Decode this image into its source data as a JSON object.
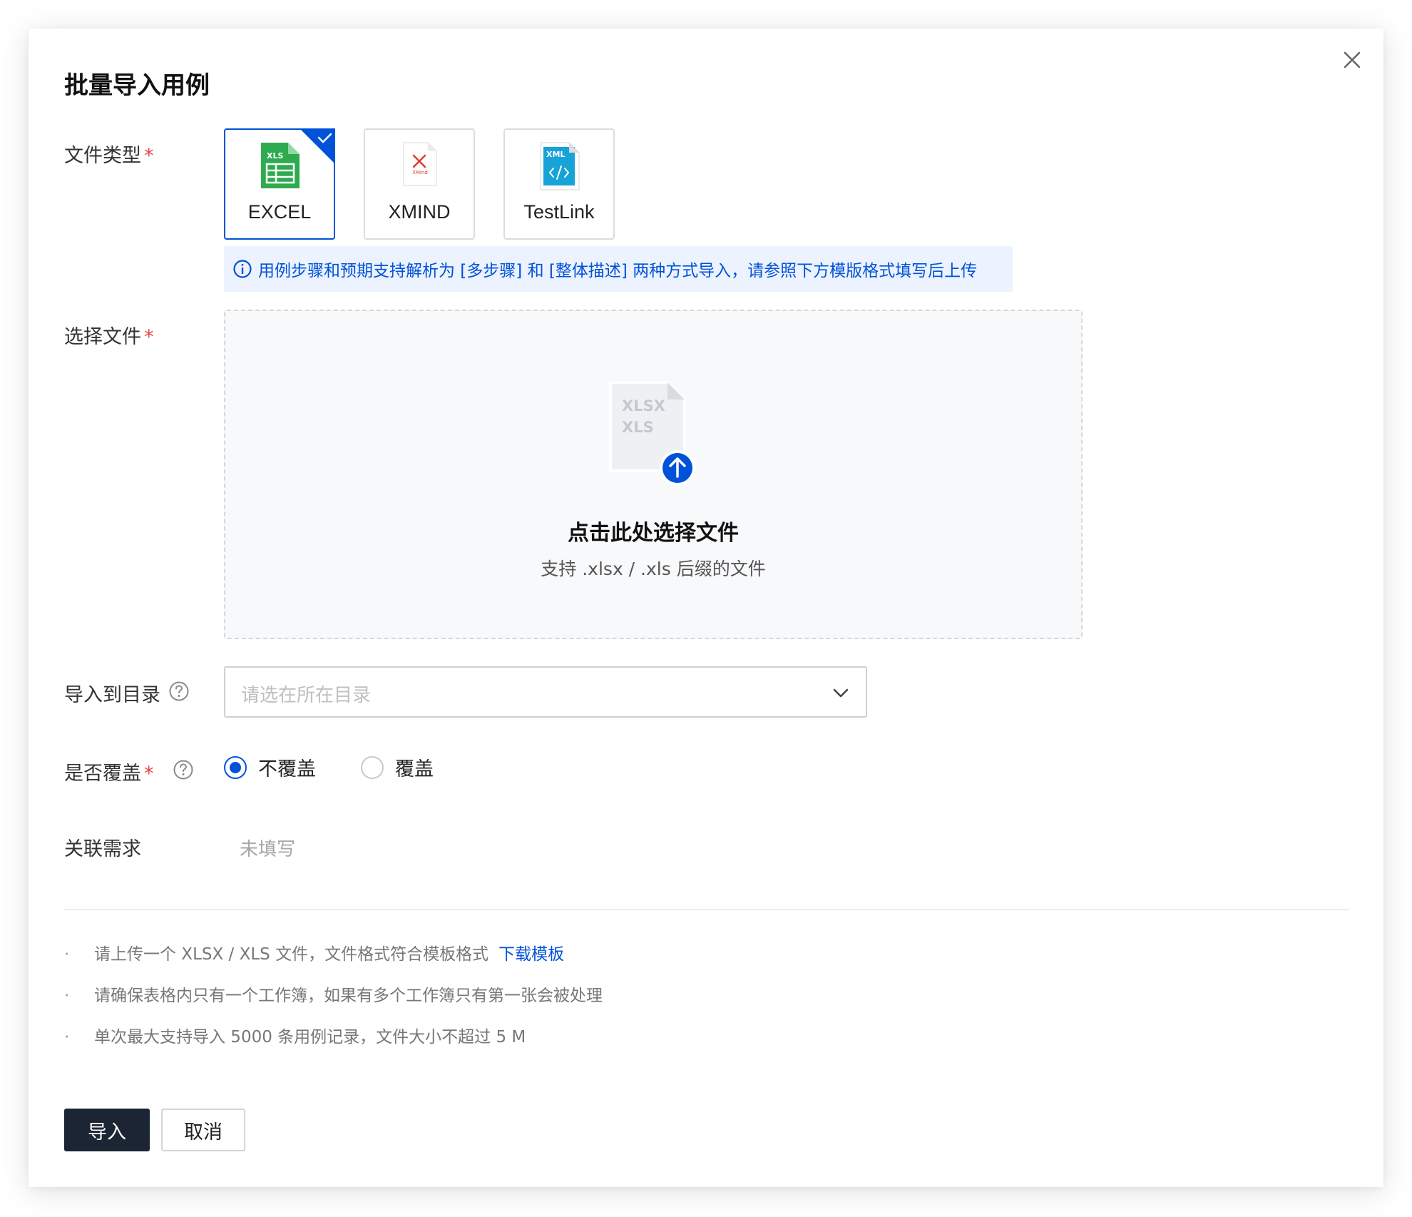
{
  "dialog": {
    "title": "批量导入用例",
    "close_icon": "close-icon"
  },
  "form": {
    "file_type": {
      "label": "文件类型",
      "required_mark": "*",
      "options": [
        {
          "label": "EXCEL",
          "badge": "XLS",
          "icon": "excel-file-icon",
          "color": "#2eaa4f",
          "selected": true
        },
        {
          "label": "XMIND",
          "badge": "XMind",
          "icon": "xmind-file-icon",
          "color": "#e03c31",
          "selected": false
        },
        {
          "label": "TestLink",
          "badge": "XML",
          "icon": "xml-file-icon",
          "color": "#17a3d8",
          "selected": false
        }
      ]
    },
    "info_tip": "用例步骤和预期支持解析为 [多步骤] 和 [整体描述] 两种方式导入，请参照下方模版格式填写后上传",
    "select_file": {
      "label": "选择文件",
      "required_mark": "*",
      "file_badge_1": "XLSX",
      "file_badge_2": "XLS",
      "title": "点击此处选择文件",
      "subtitle": "支持 .xlsx / .xls 后缀的文件"
    },
    "directory": {
      "label": "导入到目录",
      "placeholder": "请选在所在目录"
    },
    "overwrite": {
      "label": "是否覆盖",
      "required_mark": "*",
      "options": [
        {
          "label": "不覆盖",
          "checked": true
        },
        {
          "label": "覆盖",
          "checked": false
        }
      ]
    },
    "requirement": {
      "label": "关联需求",
      "value": "未填写"
    }
  },
  "notes": {
    "bullet": "·",
    "items": [
      "请上传一个 XLSX / XLS 文件，文件格式符合模板格式",
      "请确保表格内只有一个工作簿，如果有多个工作簿只有第一张会被处理",
      "单次最大支持导入 5000 条用例记录，文件大小不超过 5 M"
    ],
    "download_link": "下载模板"
  },
  "footer": {
    "import_label": "导入",
    "cancel_label": "取消"
  },
  "colors": {
    "brand": "#0052d9",
    "primary_button": "#1c2533",
    "required": "#e54545",
    "info_bg": "#ecf2fe"
  }
}
